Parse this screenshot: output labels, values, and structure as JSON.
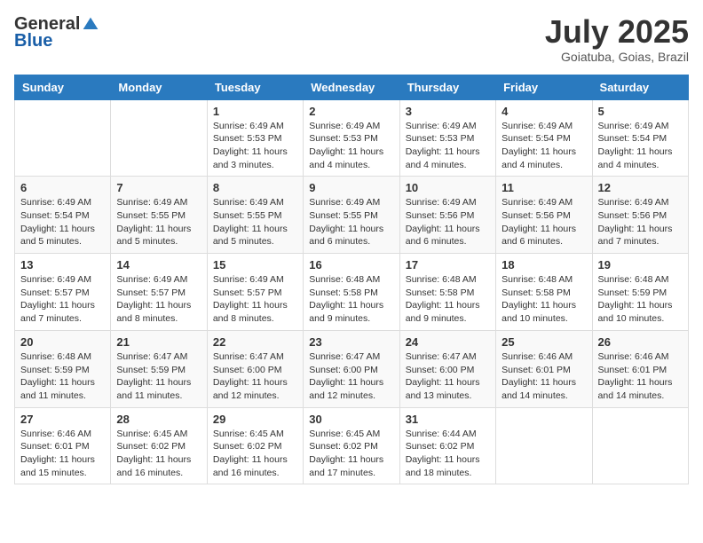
{
  "header": {
    "logo_general": "General",
    "logo_blue": "Blue",
    "month_title": "July 2025",
    "location": "Goiatuba, Goias, Brazil"
  },
  "weekdays": [
    "Sunday",
    "Monday",
    "Tuesday",
    "Wednesday",
    "Thursday",
    "Friday",
    "Saturday"
  ],
  "weeks": [
    [
      null,
      null,
      {
        "day": 1,
        "sunrise": "6:49 AM",
        "sunset": "5:53 PM",
        "daylight": "11 hours and 3 minutes."
      },
      {
        "day": 2,
        "sunrise": "6:49 AM",
        "sunset": "5:53 PM",
        "daylight": "11 hours and 4 minutes."
      },
      {
        "day": 3,
        "sunrise": "6:49 AM",
        "sunset": "5:53 PM",
        "daylight": "11 hours and 4 minutes."
      },
      {
        "day": 4,
        "sunrise": "6:49 AM",
        "sunset": "5:54 PM",
        "daylight": "11 hours and 4 minutes."
      },
      {
        "day": 5,
        "sunrise": "6:49 AM",
        "sunset": "5:54 PM",
        "daylight": "11 hours and 4 minutes."
      }
    ],
    [
      {
        "day": 6,
        "sunrise": "6:49 AM",
        "sunset": "5:54 PM",
        "daylight": "11 hours and 5 minutes."
      },
      {
        "day": 7,
        "sunrise": "6:49 AM",
        "sunset": "5:55 PM",
        "daylight": "11 hours and 5 minutes."
      },
      {
        "day": 8,
        "sunrise": "6:49 AM",
        "sunset": "5:55 PM",
        "daylight": "11 hours and 5 minutes."
      },
      {
        "day": 9,
        "sunrise": "6:49 AM",
        "sunset": "5:55 PM",
        "daylight": "11 hours and 6 minutes."
      },
      {
        "day": 10,
        "sunrise": "6:49 AM",
        "sunset": "5:56 PM",
        "daylight": "11 hours and 6 minutes."
      },
      {
        "day": 11,
        "sunrise": "6:49 AM",
        "sunset": "5:56 PM",
        "daylight": "11 hours and 6 minutes."
      },
      {
        "day": 12,
        "sunrise": "6:49 AM",
        "sunset": "5:56 PM",
        "daylight": "11 hours and 7 minutes."
      }
    ],
    [
      {
        "day": 13,
        "sunrise": "6:49 AM",
        "sunset": "5:57 PM",
        "daylight": "11 hours and 7 minutes."
      },
      {
        "day": 14,
        "sunrise": "6:49 AM",
        "sunset": "5:57 PM",
        "daylight": "11 hours and 8 minutes."
      },
      {
        "day": 15,
        "sunrise": "6:49 AM",
        "sunset": "5:57 PM",
        "daylight": "11 hours and 8 minutes."
      },
      {
        "day": 16,
        "sunrise": "6:48 AM",
        "sunset": "5:58 PM",
        "daylight": "11 hours and 9 minutes."
      },
      {
        "day": 17,
        "sunrise": "6:48 AM",
        "sunset": "5:58 PM",
        "daylight": "11 hours and 9 minutes."
      },
      {
        "day": 18,
        "sunrise": "6:48 AM",
        "sunset": "5:58 PM",
        "daylight": "11 hours and 10 minutes."
      },
      {
        "day": 19,
        "sunrise": "6:48 AM",
        "sunset": "5:59 PM",
        "daylight": "11 hours and 10 minutes."
      }
    ],
    [
      {
        "day": 20,
        "sunrise": "6:48 AM",
        "sunset": "5:59 PM",
        "daylight": "11 hours and 11 minutes."
      },
      {
        "day": 21,
        "sunrise": "6:47 AM",
        "sunset": "5:59 PM",
        "daylight": "11 hours and 11 minutes."
      },
      {
        "day": 22,
        "sunrise": "6:47 AM",
        "sunset": "6:00 PM",
        "daylight": "11 hours and 12 minutes."
      },
      {
        "day": 23,
        "sunrise": "6:47 AM",
        "sunset": "6:00 PM",
        "daylight": "11 hours and 12 minutes."
      },
      {
        "day": 24,
        "sunrise": "6:47 AM",
        "sunset": "6:00 PM",
        "daylight": "11 hours and 13 minutes."
      },
      {
        "day": 25,
        "sunrise": "6:46 AM",
        "sunset": "6:01 PM",
        "daylight": "11 hours and 14 minutes."
      },
      {
        "day": 26,
        "sunrise": "6:46 AM",
        "sunset": "6:01 PM",
        "daylight": "11 hours and 14 minutes."
      }
    ],
    [
      {
        "day": 27,
        "sunrise": "6:46 AM",
        "sunset": "6:01 PM",
        "daylight": "11 hours and 15 minutes."
      },
      {
        "day": 28,
        "sunrise": "6:45 AM",
        "sunset": "6:02 PM",
        "daylight": "11 hours and 16 minutes."
      },
      {
        "day": 29,
        "sunrise": "6:45 AM",
        "sunset": "6:02 PM",
        "daylight": "11 hours and 16 minutes."
      },
      {
        "day": 30,
        "sunrise": "6:45 AM",
        "sunset": "6:02 PM",
        "daylight": "11 hours and 17 minutes."
      },
      {
        "day": 31,
        "sunrise": "6:44 AM",
        "sunset": "6:02 PM",
        "daylight": "11 hours and 18 minutes."
      },
      null,
      null
    ]
  ]
}
